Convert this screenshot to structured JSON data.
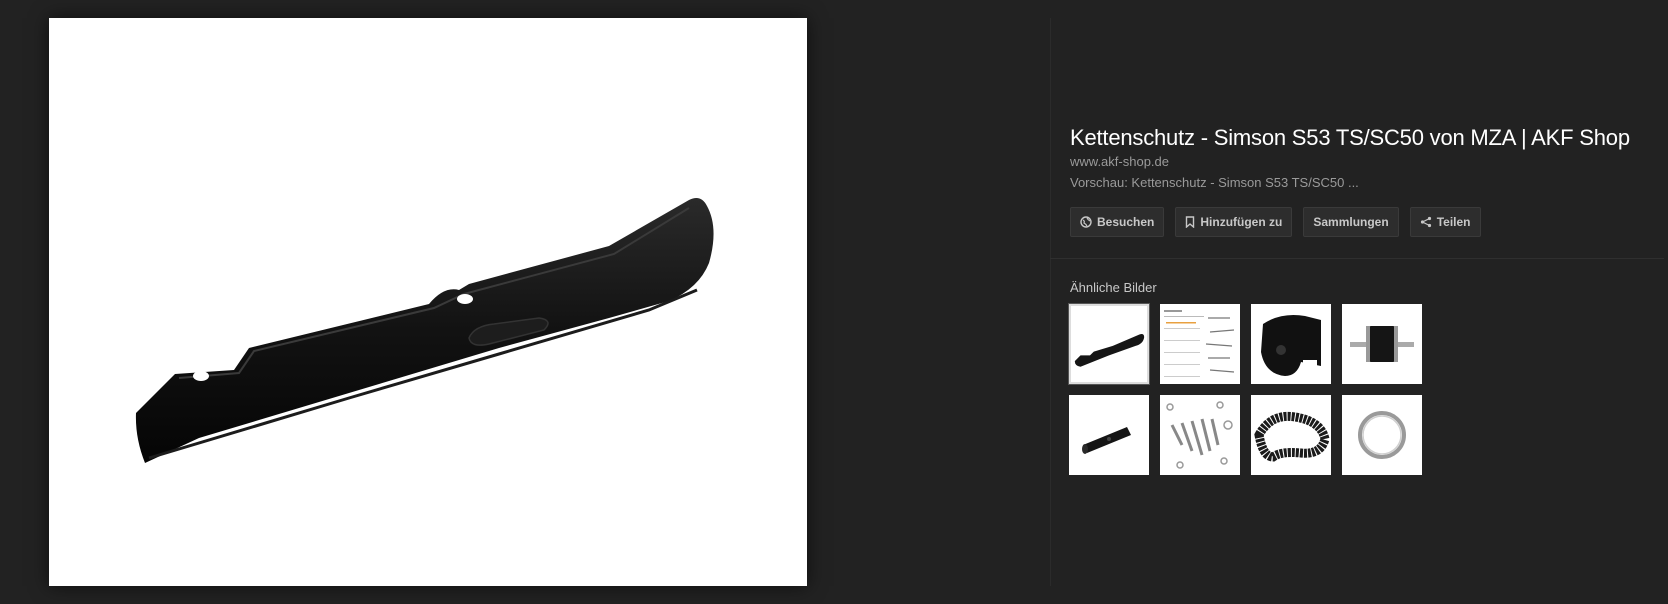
{
  "result": {
    "title": "Kettenschutz - Simson S53 TS/SC50 von MZA | AKF Shop",
    "site": "www.akf-shop.de",
    "preview": "Vorschau: Kettenschutz - Simson S53 TS/SC50 ..."
  },
  "actions": {
    "visit_label": "Besuchen",
    "add_label": "Hinzufügen zu",
    "collections_label": "Sammlungen",
    "share_label": "Teilen"
  },
  "similar": {
    "label": "Ähnliche Bilder",
    "items": [
      "chain-guard",
      "parts-list-document",
      "black-chain-cover",
      "rubber-buffer",
      "black-tube",
      "bolts-set",
      "chain",
      "key-ring"
    ]
  },
  "colors": {
    "background": "#222222",
    "title": "#ffffff",
    "muted": "#9a9a9a",
    "button_bg": "#2d2d2d"
  },
  "icons": {
    "visit": "globe-icon",
    "add": "bookmark-icon",
    "share": "share-icon"
  }
}
